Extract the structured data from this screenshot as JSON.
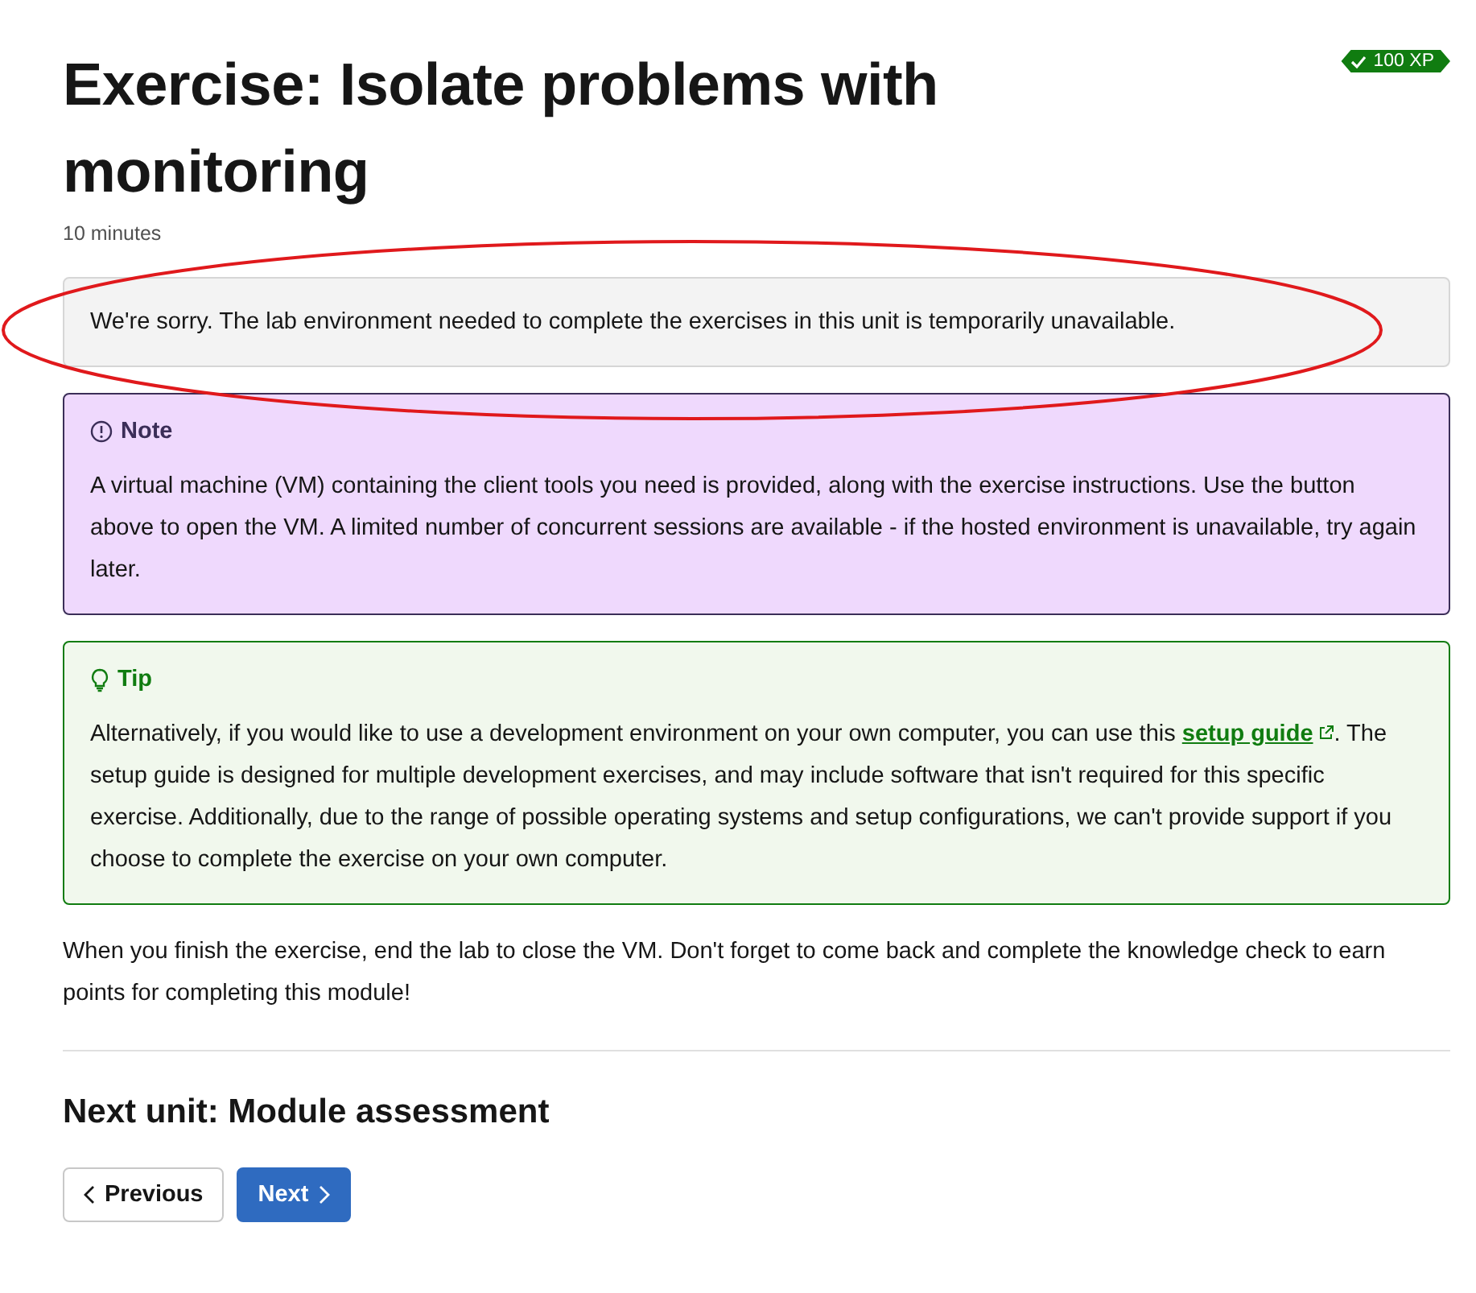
{
  "title": "Exercise: Isolate problems with monitoring",
  "xp_badge": "100 XP",
  "duration": "10 minutes",
  "unavailable_notice": "We're sorry. The lab environment needed to complete the exercises in this unit is temporarily unavailable.",
  "note": {
    "heading": "Note",
    "text": "A virtual machine (VM) containing the client tools you need is provided, along with the exercise instructions. Use the button above to open the VM. A limited number of concurrent sessions are available - if the hosted environment is unavailable, try again later."
  },
  "tip": {
    "heading": "Tip",
    "text_before": "Alternatively, if you would like to use a development environment on your own computer, you can use this",
    "link": "setup guide",
    "text_after": ". The setup guide is designed for multiple development exercises, and may include software that isn't required for this specific exercise. Additionally, due to the range of possible operating systems and setup configurations, we can't provide support if you choose to complete the exercise on your own computer."
  },
  "closing": "When you finish the exercise, end the lab to close the VM. Don't forget to come back and complete the knowledge check to earn points for completing this module!",
  "next_unit": "Next unit: Module assessment",
  "buttons": [
    {
      "label": "Previous",
      "kind": "secondary"
    },
    {
      "label": "Next",
      "kind": "primary"
    }
  ]
}
